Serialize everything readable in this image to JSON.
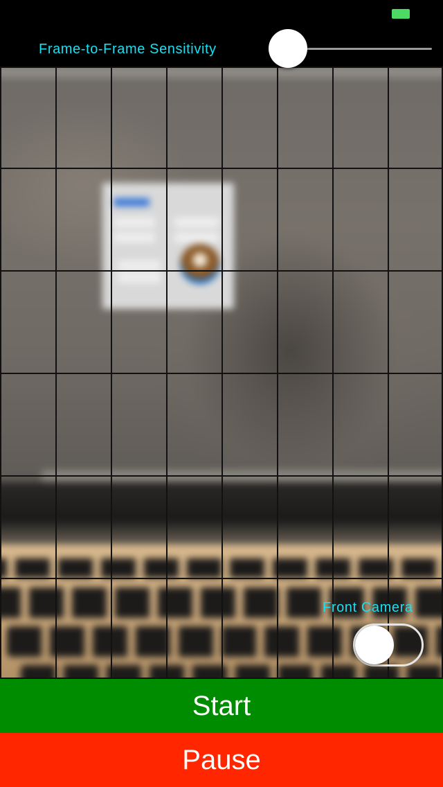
{
  "status_bar": {
    "battery_color": "#4cd964",
    "battery_icon": "battery-icon"
  },
  "sensitivity": {
    "label": "Frame-to-Frame Sensitivity",
    "slider_value": 0.0,
    "label_color": "#19e0f0"
  },
  "camera": {
    "grid_columns": 8,
    "grid_rows": 6
  },
  "front_camera": {
    "label": "Front Camera",
    "enabled": false
  },
  "buttons": {
    "start_label": "Start",
    "start_color": "#008c00",
    "pause_label": "Pause",
    "pause_color": "#ff2600"
  }
}
